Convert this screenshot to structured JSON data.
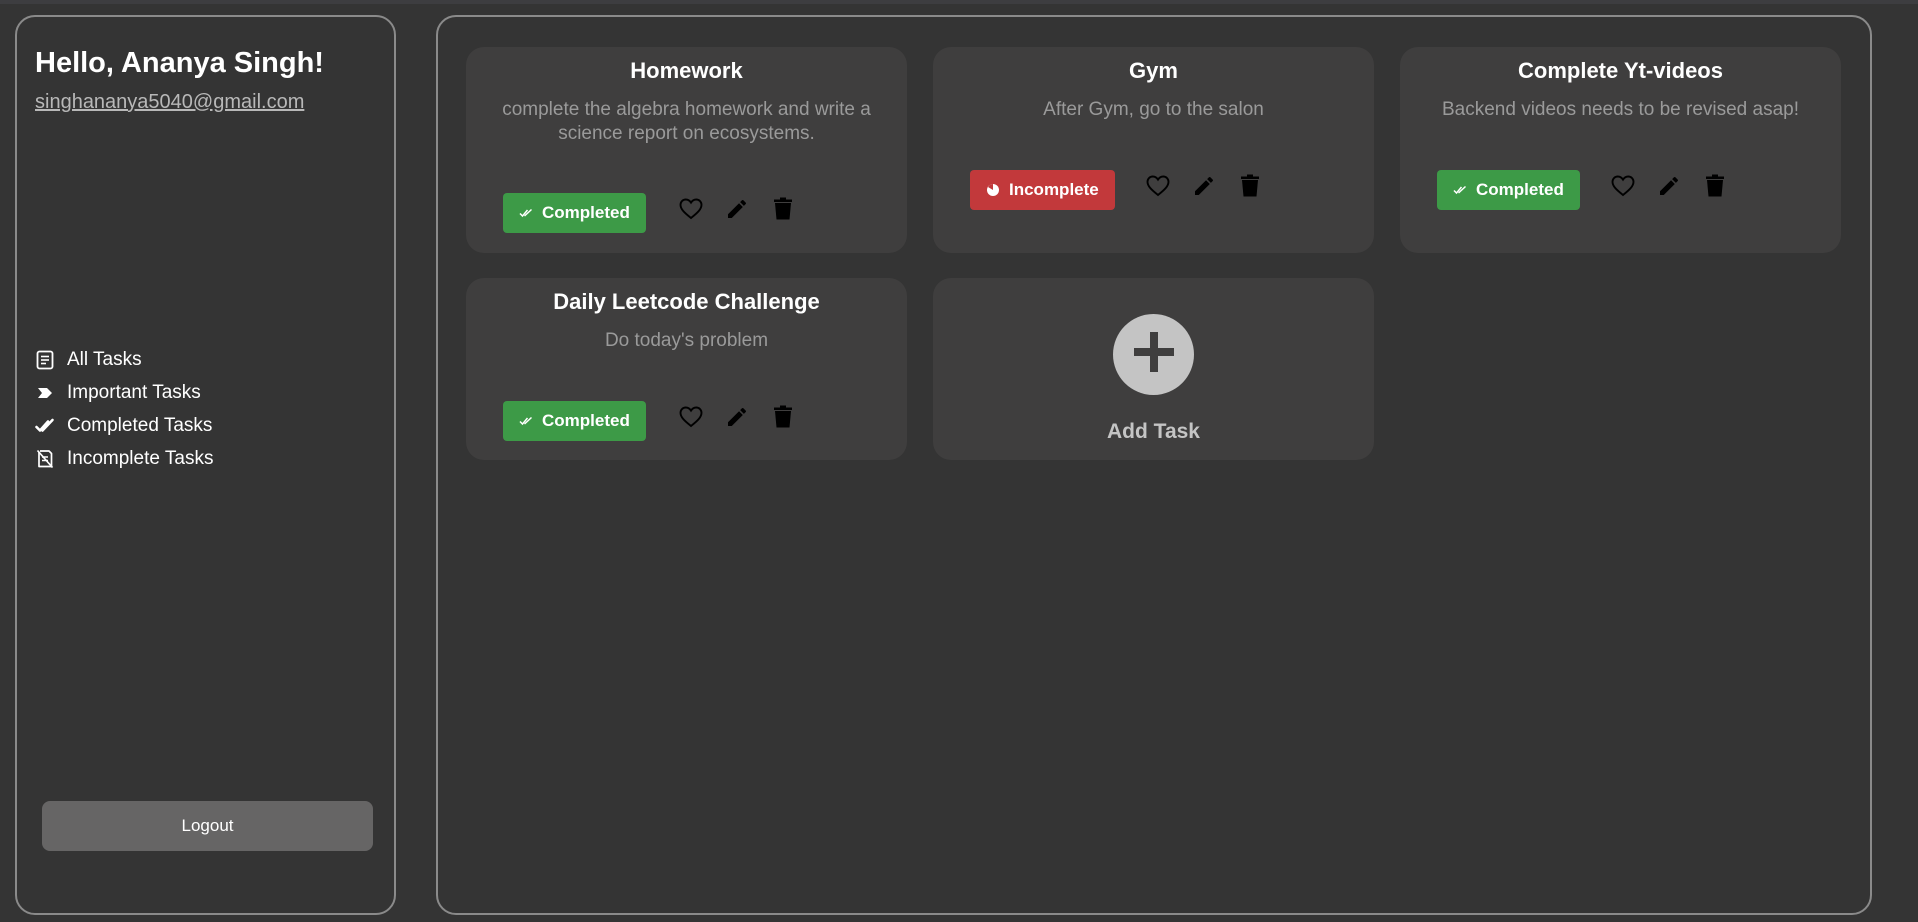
{
  "sidebar": {
    "greeting": "Hello, Ananya Singh!",
    "email": "singhananya5040@gmail.com",
    "nav": [
      {
        "label": "All Tasks",
        "icon": "notes-icon"
      },
      {
        "label": "Important Tasks",
        "icon": "label-arrow-icon"
      },
      {
        "label": "Completed Tasks",
        "icon": "double-check-icon"
      },
      {
        "label": "Incomplete Tasks",
        "icon": "note-off-icon"
      }
    ],
    "logout_label": "Logout"
  },
  "tasks": [
    {
      "title": "Homework",
      "description": "complete the algebra homework and write a science report on ecosystems.",
      "status": "Completed"
    },
    {
      "title": "Gym",
      "description": "After Gym, go to the salon",
      "status": "Incomplete"
    },
    {
      "title": "Complete Yt-videos",
      "description": "Backend videos needs to be revised asap!",
      "status": "Completed"
    },
    {
      "title": "Daily Leetcode Challenge",
      "description": "Do today's problem",
      "status": "Completed"
    }
  ],
  "add_task_label": "Add Task",
  "colors": {
    "background": "#343434",
    "card": "#3f3e3e",
    "completed": "#3d9a47",
    "incomplete": "#c2393b",
    "border": "#8a8a8a",
    "logout_button": "#666565",
    "muted_text": "#9a9a9a"
  }
}
